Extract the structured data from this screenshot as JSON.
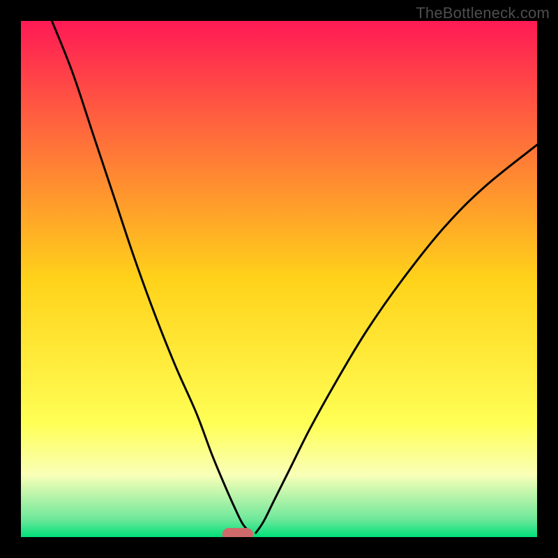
{
  "watermark": "TheBottleneck.com",
  "chart_data": {
    "type": "line",
    "title": "",
    "xlabel": "",
    "ylabel": "",
    "xlim": [
      0,
      100
    ],
    "ylim": [
      0,
      100
    ],
    "grid": false,
    "legend": false,
    "background_gradient_stops": [
      {
        "pos": 0.0,
        "color": "#ff1a55"
      },
      {
        "pos": 0.5,
        "color": "#ffd21a"
      },
      {
        "pos": 0.78,
        "color": "#ffff55"
      },
      {
        "pos": 0.88,
        "color": "#f9ffb8"
      },
      {
        "pos": 0.965,
        "color": "#6fe89b"
      },
      {
        "pos": 1.0,
        "color": "#00e079"
      }
    ],
    "notch": {
      "x": 42,
      "y": 0.5,
      "width": 6,
      "height": 2.5,
      "color": "#cf6a6a"
    },
    "series": [
      {
        "name": "left-curve",
        "x": [
          6,
          10,
          14,
          18,
          22,
          26,
          30,
          34,
          37,
          39.5,
          41.5,
          43,
          44.5
        ],
        "values": [
          100,
          90,
          78,
          66,
          54,
          43,
          33,
          24,
          16,
          10,
          5.5,
          2.5,
          0.8
        ]
      },
      {
        "name": "right-curve",
        "x": [
          45.5,
          47,
          49,
          52,
          56,
          61,
          67,
          74,
          82,
          90,
          100
        ],
        "values": [
          0.8,
          3,
          7,
          13,
          21,
          30,
          40,
          50,
          60,
          68,
          76
        ]
      }
    ]
  }
}
